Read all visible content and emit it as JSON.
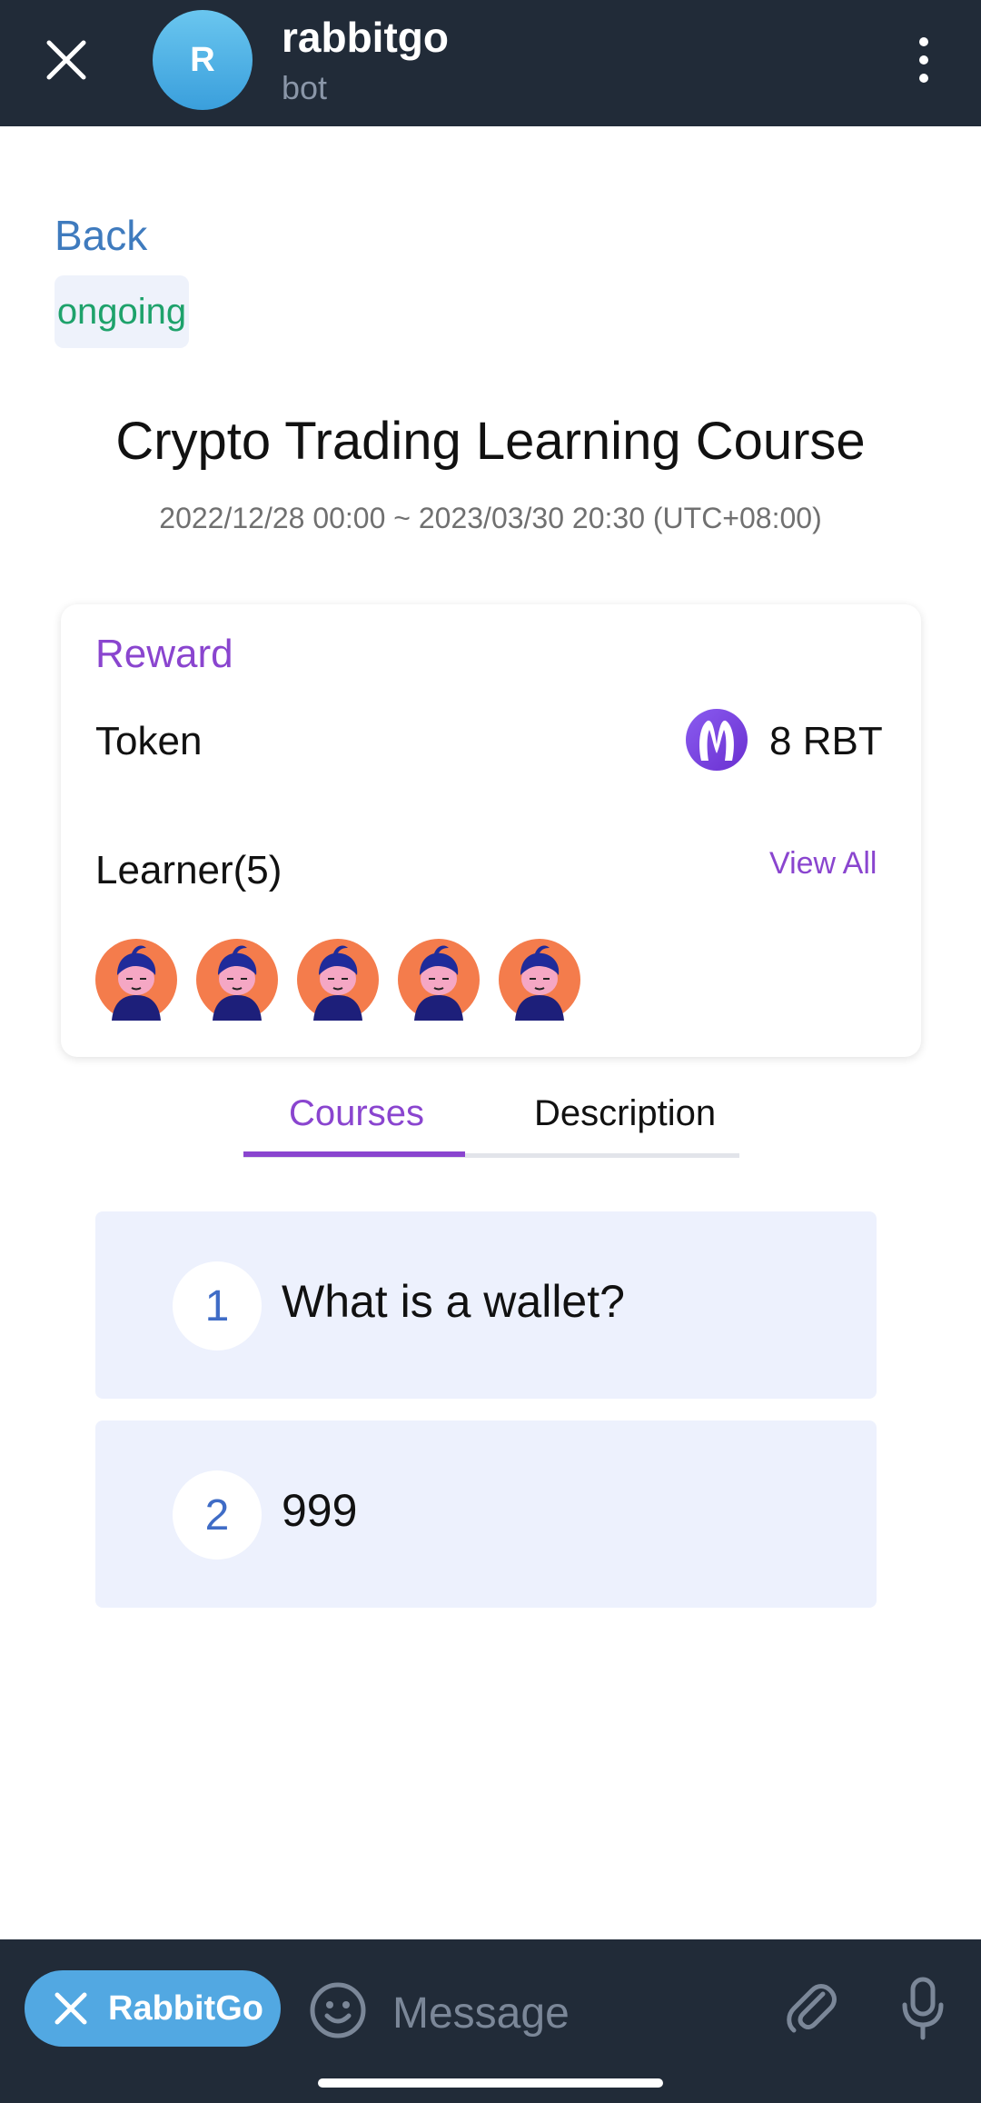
{
  "header": {
    "avatar_letter": "R",
    "title": "rabbitgo",
    "subtitle": "bot",
    "background": "#212b38"
  },
  "nav": {
    "back_label": "Back"
  },
  "status": {
    "label": "ongoing",
    "color": "#1ea26b"
  },
  "course": {
    "title": "Crypto Trading Learning Course",
    "dates": "2022/12/28 00:00 ~ 2023/03/30 20:30 (UTC+08:00)"
  },
  "reward": {
    "title": "Reward",
    "token_label": "Token",
    "token_icon": "rabbit-token-icon",
    "token_amount": "8 RBT",
    "accent": "#8a45cf"
  },
  "learners": {
    "label": "Learner(5)",
    "view_all": "View All",
    "avatars": [
      "learner-avatar",
      "learner-avatar",
      "learner-avatar",
      "learner-avatar",
      "learner-avatar"
    ]
  },
  "tabs": [
    {
      "label": "Courses",
      "active": true
    },
    {
      "label": "Description",
      "active": false
    }
  ],
  "lessons": [
    {
      "number": "1",
      "title": "What is a wallet?"
    },
    {
      "number": "2",
      "title": "999"
    }
  ],
  "bottom_bar": {
    "bot_button_label": "RabbitGo",
    "message_placeholder": "Message",
    "accent": "#52a8e2"
  }
}
